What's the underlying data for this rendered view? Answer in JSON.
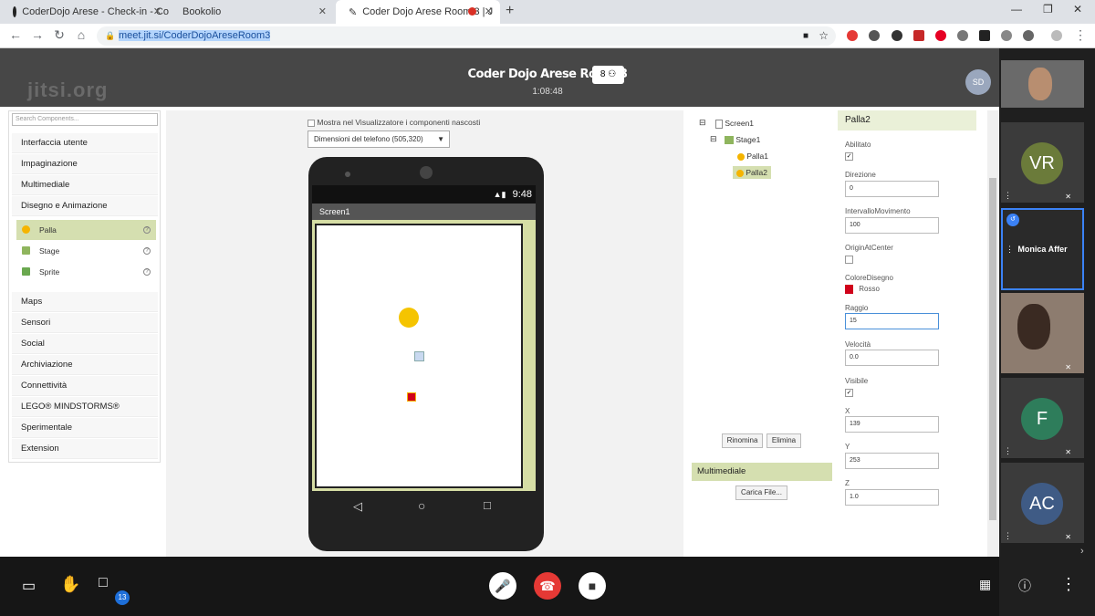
{
  "browser": {
    "tabs": [
      {
        "title": "CoderDojo Arese - Check-in - Co",
        "active": false
      },
      {
        "title": "Bookolio",
        "active": false
      },
      {
        "title": "Coder Dojo Arese Room 3 | J",
        "active": true
      }
    ],
    "new_tab": "+",
    "url": "meet.jit.si/CoderDojoAreseRoom3"
  },
  "meeting": {
    "logo": "jitsi.org",
    "title": "Coder Dojo Arese Room 3",
    "time": "1:08:48",
    "participant_count": "8",
    "self_avatar": "SD"
  },
  "appinventor": {
    "search_placeholder": "Search Components...",
    "palette": [
      "Interfaccia utente",
      "Impaginazione",
      "Multimediale",
      "Disegno e Animazione"
    ],
    "drawing_items": [
      "Palla",
      "Stage",
      "Sprite"
    ],
    "palette_more": [
      "Maps",
      "Sensori",
      "Social",
      "Archiviazione",
      "Connettività",
      "LEGO® MINDSTORMS®",
      "Sperimentale",
      "Extension"
    ],
    "show_hidden_label": "Mostra nel Visualizzatore i componenti nascosti",
    "phone_size": "Dimensioni del telefono (505,320)",
    "status_time": "9:48",
    "screen_title": "Screen1",
    "tree": {
      "screen": "Screen1",
      "stage": "Stage1",
      "ball1": "Palla1",
      "ball2": "Palla2"
    },
    "rename_button": "Rinomina",
    "delete_button": "Elimina",
    "media_header": "Multimediale",
    "upload_button": "Carica File...",
    "properties": {
      "header": "Palla2",
      "enabled_label": "Abilitato",
      "enabled_check": "✓",
      "direction_label": "Direzione",
      "direction": "0",
      "interval_label": "IntervalloMovimento",
      "interval": "100",
      "origin_label": "OriginAtCenter",
      "color_label": "ColoreDisegno",
      "color_value": "Rosso",
      "color_hex": "#d0021b",
      "radius_label": "Raggio",
      "radius": "15",
      "speed_label": "Velocità",
      "speed": "0.0",
      "visible_label": "Visibile",
      "visible_check": "✓",
      "x_label": "X",
      "x": "139",
      "y_label": "Y",
      "y": "253",
      "z_label": "Z",
      "z": "1.0"
    }
  },
  "participants": [
    {
      "initials": "VR",
      "color": "#6b7b3a"
    },
    {
      "name": "Monica Affer"
    },
    {
      "initials": "F",
      "color": "#2e7d5b"
    },
    {
      "initials": "AC",
      "color": "#3f5b85"
    }
  ],
  "toolbar": {
    "chat_badge": "13"
  }
}
